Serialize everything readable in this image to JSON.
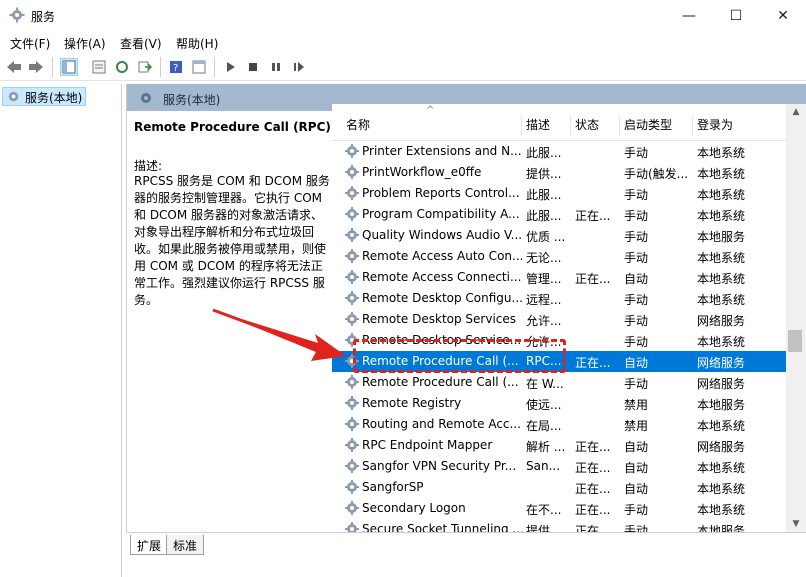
{
  "window": {
    "title": "服务",
    "minimize": "—",
    "maximize": "☐",
    "close": "✕"
  },
  "menu": [
    "文件(F)",
    "操作(A)",
    "查看(V)",
    "帮助(H)"
  ],
  "toolbar": {
    "icons": [
      "back-icon",
      "forward-icon",
      "console-tree-icon",
      "properties-icon",
      "refresh-icon",
      "export-icon",
      "help-icon",
      "view-icon",
      "start-icon",
      "stop-icon",
      "pause-icon",
      "restart-icon"
    ]
  },
  "tree": {
    "item": "服务(本地)"
  },
  "pane": {
    "title": "服务(本地)"
  },
  "description": {
    "title": "Remote Procedure Call (RPC)",
    "label": "描述:",
    "body": "RPCSS 服务是 COM 和 DCOM 服务器的服务控制管理器。它执行 COM 和 DCOM 服务器的对象激活请求、对象导出程序解析和分布式垃圾回收。如果此服务被停用或禁用，则使用 COM 或 DCOM 的程序将无法正常工作。强烈建议你运行 RPCSS 服务。"
  },
  "list": {
    "columns": [
      "名称",
      "描述",
      "状态",
      "启动类型",
      "登录为"
    ],
    "sort_indicator": "^",
    "selected_index": 10,
    "rows": [
      {
        "name": "Printer Extensions and N...",
        "desc": "此服...",
        "status": "",
        "startup": "手动",
        "logon": "本地系统"
      },
      {
        "name": "PrintWorkflow_e0ffe",
        "desc": "提供...",
        "status": "",
        "startup": "手动(触发...",
        "logon": "本地系统"
      },
      {
        "name": "Problem Reports Control...",
        "desc": "此服...",
        "status": "",
        "startup": "手动",
        "logon": "本地系统"
      },
      {
        "name": "Program Compatibility A...",
        "desc": "此服...",
        "status": "正在...",
        "startup": "手动",
        "logon": "本地系统"
      },
      {
        "name": "Quality Windows Audio V...",
        "desc": "优质 ...",
        "status": "",
        "startup": "手动",
        "logon": "本地服务"
      },
      {
        "name": "Remote Access Auto Con...",
        "desc": "无论...",
        "status": "",
        "startup": "手动",
        "logon": "本地系统"
      },
      {
        "name": "Remote Access Connecti...",
        "desc": "管理...",
        "status": "正在...",
        "startup": "自动",
        "logon": "本地系统"
      },
      {
        "name": "Remote Desktop Configu...",
        "desc": "远程...",
        "status": "",
        "startup": "手动",
        "logon": "本地系统"
      },
      {
        "name": "Remote Desktop Services",
        "desc": "允许...",
        "status": "",
        "startup": "手动",
        "logon": "网络服务"
      },
      {
        "name": "Remote Desktop Service...",
        "desc": "允许...",
        "status": "",
        "startup": "手动",
        "logon": "本地系统"
      },
      {
        "name": "Remote Procedure Call (...",
        "desc": "RPC...",
        "status": "正在...",
        "startup": "自动",
        "logon": "网络服务"
      },
      {
        "name": "Remote Procedure Call (...",
        "desc": "在 W...",
        "status": "",
        "startup": "手动",
        "logon": "网络服务"
      },
      {
        "name": "Remote Registry",
        "desc": "使远...",
        "status": "",
        "startup": "禁用",
        "logon": "本地服务"
      },
      {
        "name": "Routing and Remote Acc...",
        "desc": "在局...",
        "status": "",
        "startup": "禁用",
        "logon": "本地系统"
      },
      {
        "name": "RPC Endpoint Mapper",
        "desc": "解析 ...",
        "status": "正在...",
        "startup": "自动",
        "logon": "网络服务"
      },
      {
        "name": "Sangfor VPN Security Pr...",
        "desc": "San...",
        "status": "正在...",
        "startup": "自动",
        "logon": "本地系统"
      },
      {
        "name": "SangforSP",
        "desc": "",
        "status": "正在...",
        "startup": "自动",
        "logon": "本地系统"
      },
      {
        "name": "Secondary Logon",
        "desc": "在不...",
        "status": "正在...",
        "startup": "手动",
        "logon": "本地系统"
      },
      {
        "name": "Secure Socket Tunneling ...",
        "desc": "提供...",
        "status": "正在...",
        "startup": "手动",
        "logon": "本地服务"
      }
    ]
  },
  "tabs": [
    "扩展",
    "标准"
  ],
  "annotation": {
    "color": "#e0231f"
  },
  "colors": {
    "selection": "#0078d7",
    "pane_header": "#a4b8cf"
  }
}
